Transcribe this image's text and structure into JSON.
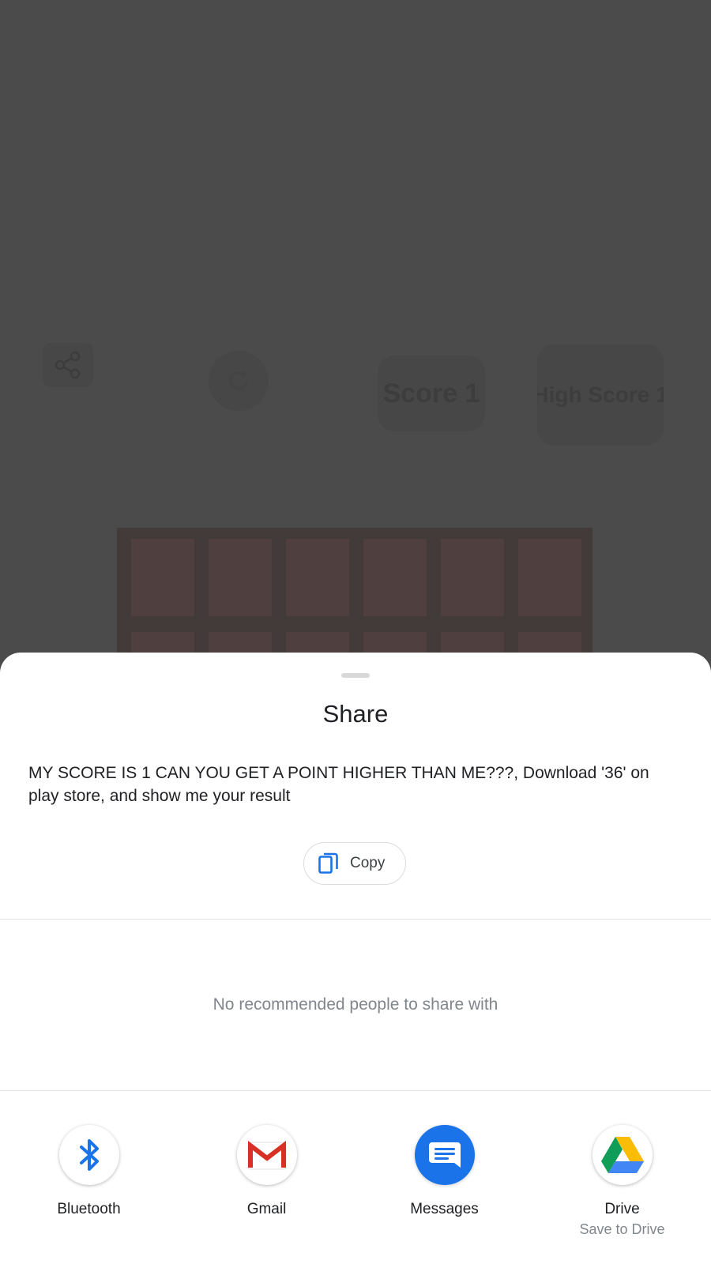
{
  "background_app": {
    "score_text": "Score 1",
    "high_score_text": "High Score 1"
  },
  "share_sheet": {
    "title": "Share",
    "shared_text": "MY SCORE IS 1 CAN YOU GET  A POINT HIGHER THAN ME???, Download '36' on play store, and show me your result",
    "copy_label": "Copy",
    "no_recommendations": "No recommended people to share with",
    "targets": [
      {
        "label": "Bluetooth",
        "sublabel": "",
        "icon": "bluetooth-icon"
      },
      {
        "label": "Gmail",
        "sublabel": "",
        "icon": "gmail-icon"
      },
      {
        "label": "Messages",
        "sublabel": "",
        "icon": "messages-icon"
      },
      {
        "label": "Drive",
        "sublabel": "Save to Drive",
        "icon": "drive-icon"
      }
    ]
  },
  "colors": {
    "scrim": "#4b4b4b",
    "sheet_background": "#ffffff",
    "accent_blue": "#1a73e8",
    "secondary_text": "#80868b"
  }
}
